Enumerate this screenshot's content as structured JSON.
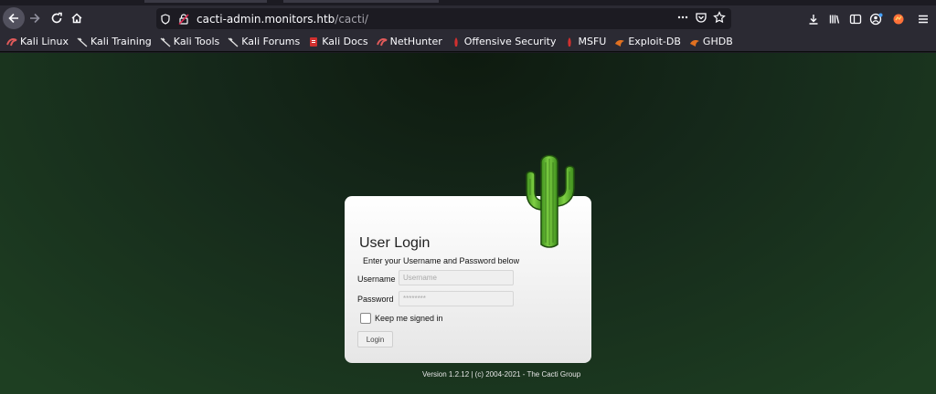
{
  "browser": {
    "url_host": "cacti-admin.monitors.htb",
    "url_path": "/cacti/"
  },
  "bookmarks": [
    {
      "label": "Kali Linux",
      "icon": "kali-dragon-icon",
      "color": "#e05a5a"
    },
    {
      "label": "Kali Training",
      "icon": "kali-dragon-icon",
      "color": "#111111"
    },
    {
      "label": "Kali Tools",
      "icon": "kali-dragon-icon",
      "color": "#111111"
    },
    {
      "label": "Kali Forums",
      "icon": "kali-dragon-icon",
      "color": "#111111"
    },
    {
      "label": "Kali Docs",
      "icon": "docs-icon",
      "color": "#d0302f"
    },
    {
      "label": "NetHunter",
      "icon": "kali-dragon-icon",
      "color": "#e05a5a"
    },
    {
      "label": "Offensive Security",
      "icon": "offsec-icon",
      "color": "#d0302f"
    },
    {
      "label": "MSFU",
      "icon": "offsec-icon",
      "color": "#d0302f"
    },
    {
      "label": "Exploit-DB",
      "icon": "exploitdb-icon",
      "color": "#e07020"
    },
    {
      "label": "GHDB",
      "icon": "exploitdb-icon",
      "color": "#e07020"
    }
  ],
  "login": {
    "title": "User Login",
    "subtitle": "Enter your Username and Password below",
    "username_label": "Username",
    "username_placeholder": "Username",
    "password_label": "Password",
    "password_placeholder": "********",
    "remember_label": "Keep me signed in",
    "login_button": "Login"
  },
  "footer": {
    "version": "Version 1.2.12 | (c) 2004-2021 - The Cacti Group"
  },
  "colors": {
    "page_bg_dark": "#0e1a0f",
    "page_bg_light": "#1e3f22",
    "cactus": "#5ab52a"
  }
}
